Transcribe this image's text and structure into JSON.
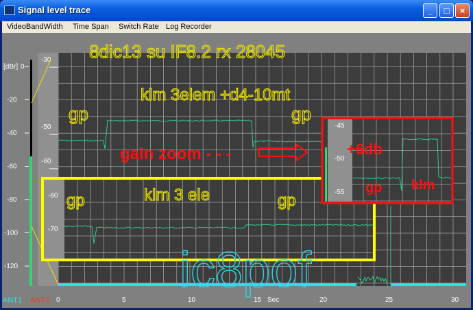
{
  "window": {
    "title": "Signal level trace",
    "minimize": "_",
    "maximize": "□",
    "close": "×"
  },
  "menu": [
    "VideoBandWidth",
    "Time Span",
    "Switch Rate",
    "Log Recorder"
  ],
  "outer_scale": {
    "unit": "[dBr]",
    "ticks": [
      "0",
      "-20",
      "-40",
      "-60",
      "-80",
      "-100",
      "-120"
    ]
  },
  "inner_scale": {
    "ticks": [
      "-30",
      "-50",
      "-60"
    ]
  },
  "overlay_scale": {
    "ticks": [
      "-60",
      "-70"
    ]
  },
  "zoom_scale": {
    "ticks": [
      "-45",
      "-50",
      "-55"
    ]
  },
  "x_axis": {
    "ticks": [
      "0",
      "5",
      "10",
      "15",
      "20",
      "25",
      "30"
    ],
    "unit": "Sec"
  },
  "legend": {
    "ant1": "ANT1",
    "ant2": "ANT2"
  },
  "annotations": {
    "header": "8dic13  su IF8.2     rx 28045",
    "setup": "klm 3elem +d4-10mt",
    "gp_left": "gp",
    "gp_right": "gp",
    "gain_zoom": "gain zoom - - -",
    "overlay_title": "klm 3 ele",
    "overlay_gp_left": "gp",
    "overlay_gp_right": "gp",
    "zoom_gain": "+6db",
    "zoom_gp": "gp",
    "zoom_klm": "klm",
    "watermark": "ic8pof"
  },
  "colors": {
    "trace": "#2ecc8a",
    "yellow": "#e8e000",
    "red": "#ff1010",
    "cyan": "#30e0e8"
  }
}
